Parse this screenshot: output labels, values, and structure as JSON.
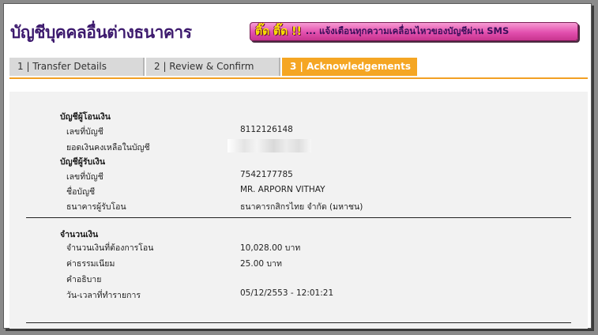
{
  "header": {
    "title": "บัญชีบุคคลอื่นต่างธนาคาร",
    "banner_prefix": "ติ๊ด ติ๊ด !!",
    "banner_text": "... แจ้งเตือนทุกความเคลื่อนไหวของบัญชีผ่าน SMS"
  },
  "tabs": [
    {
      "label": "1 | Transfer Details",
      "active": false
    },
    {
      "label": "2 | Review & Confirm",
      "active": false
    },
    {
      "label": "3 | Acknowledgements",
      "active": true
    }
  ],
  "from_account": {
    "heading": "บัญชีผู้โอนเงิน",
    "account_no_label": "เลขที่บัญชี",
    "account_no_value": "8112126148",
    "balance_label": "ยอดเงินคงเหลือในบัญชี"
  },
  "to_account": {
    "heading": "บัญชีผู้รับเงิน",
    "account_no_label": "เลขที่บัญชี",
    "account_no_value": "7542177785",
    "account_name_label": "ชื่อบัญชี",
    "account_name_value": "MR. ARPORN VITHAY",
    "bank_label": "ธนาคารผู้รับโอน",
    "bank_value": "ธนาคารกสิกรไทย จำกัด (มหาชน)"
  },
  "amount": {
    "heading": "จำนวนเงิน",
    "transfer_amount_label": "จำนวนเงินที่ต้องการโอน",
    "transfer_amount_value": "10,028.00  บาท",
    "fee_label": "ค่าธรรมเนียม",
    "fee_value": "25.00  บาท",
    "description_label": "คำอธิบาย",
    "datetime_label": "วัน-เวลาที่ทำรายการ",
    "datetime_value": "05/12/2553 - 12:01:21"
  },
  "colors": {
    "accent": "#f5a623",
    "title": "#3d1a6e",
    "banner": "#e24fae"
  }
}
